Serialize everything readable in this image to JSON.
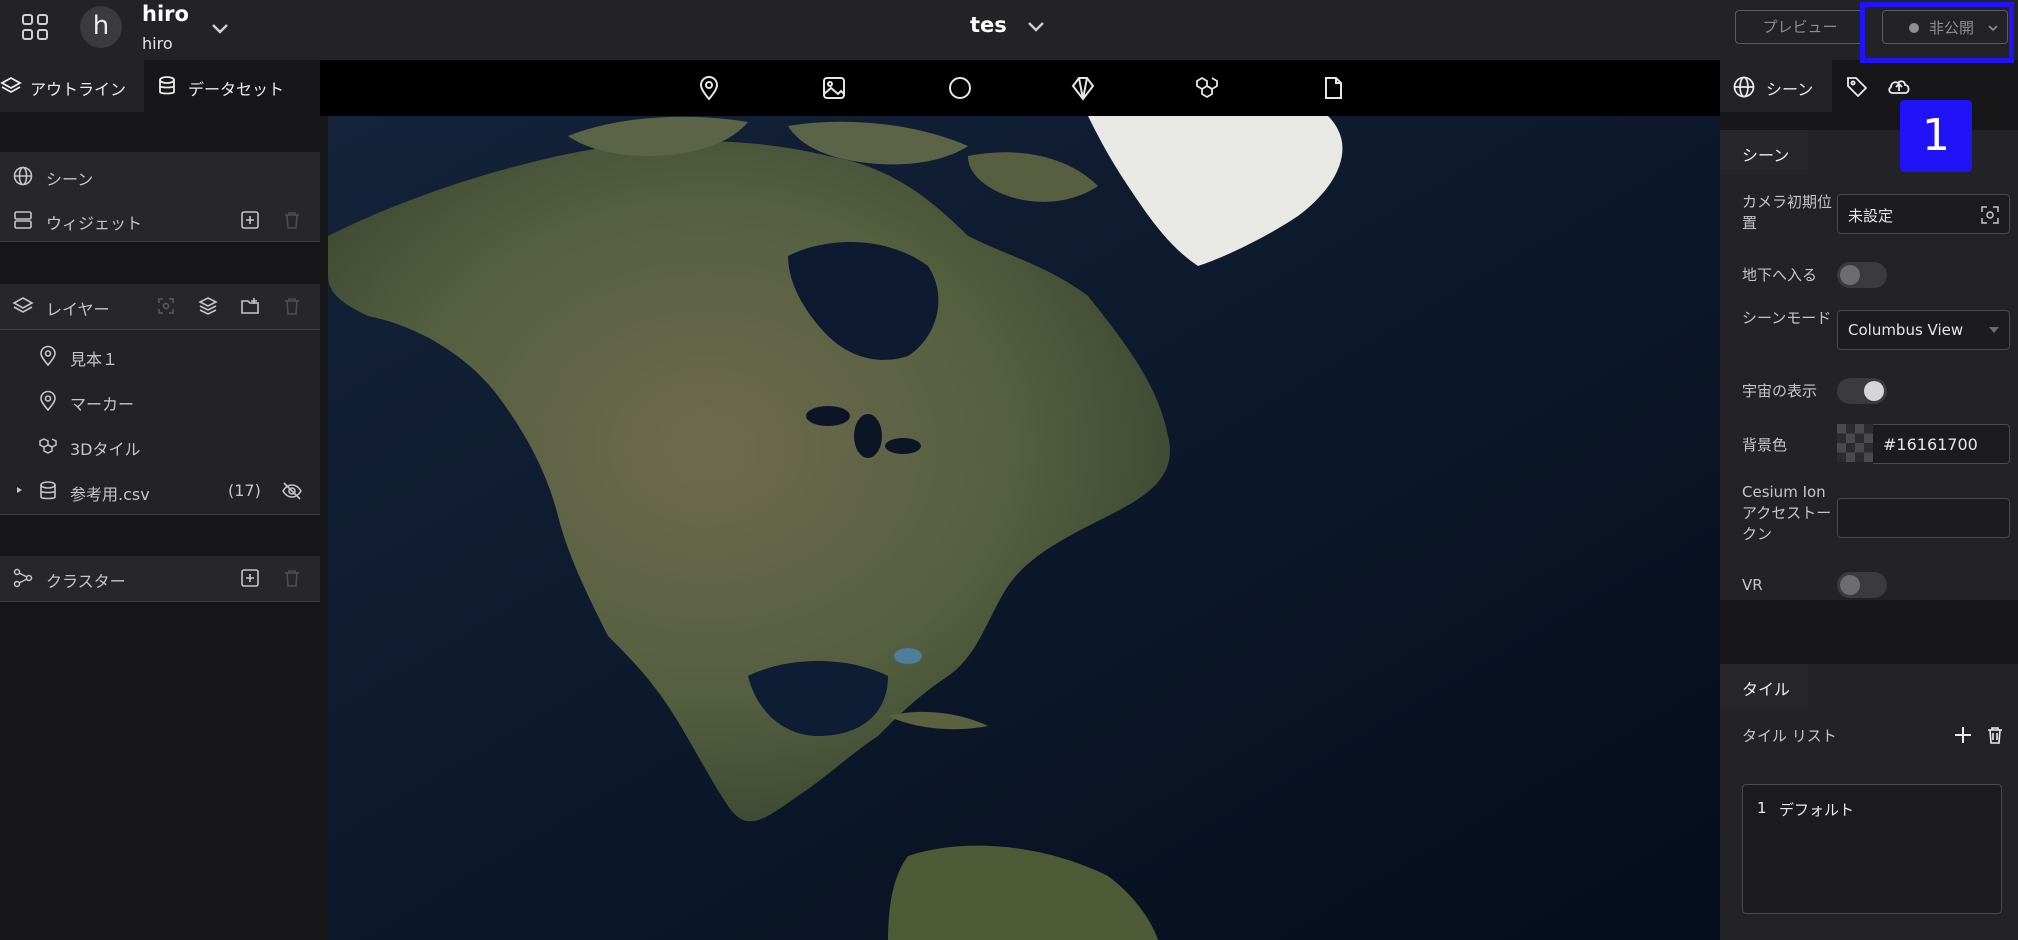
{
  "header": {
    "workspace_initial": "h",
    "workspace_name": "hiro",
    "workspace_user": "hiro",
    "project_title": "tes",
    "preview_label": "プレビュー",
    "publish_label": "非公開",
    "annotation_number": "1"
  },
  "left_panel": {
    "tabs": [
      {
        "label": "アウトライン",
        "icon": "layers-icon",
        "active": true
      },
      {
        "label": "データセット",
        "icon": "database-icon",
        "active": false
      }
    ],
    "scene_section": {
      "scene_label": "シーン",
      "widget_label": "ウィジェット"
    },
    "layer_section": {
      "header_label": "レイヤー",
      "items": [
        {
          "label": "見本１",
          "icon": "pin-icon"
        },
        {
          "label": "マーカー",
          "icon": "pin-icon"
        },
        {
          "label": "3Dタイル",
          "icon": "tiles-icon"
        },
        {
          "label": "参考用.csv",
          "icon": "database-icon",
          "count": "(17)"
        }
      ]
    },
    "cluster_section": {
      "label": "クラスター"
    }
  },
  "toolbar": {
    "tools": [
      "pin-icon",
      "image-icon",
      "circle-icon",
      "box-icon",
      "tiles-icon",
      "file-icon"
    ]
  },
  "right_panel": {
    "tabs": [
      {
        "label": "シーン",
        "icon": "globe-icon",
        "active": true
      },
      {
        "label": "",
        "icon": "tag-icon",
        "active": false
      },
      {
        "label": "",
        "icon": "cloud-upload-icon",
        "active": false
      }
    ],
    "scene_group": {
      "title": "シーン",
      "camera_label": "カメラ初期位置",
      "camera_value": "未設定",
      "underground_label": "地下へ入る",
      "underground_on": false,
      "scene_mode_label": "シーンモード",
      "scene_mode_value": "Columbus View",
      "space_label": "宇宙の表示",
      "space_on": true,
      "bg_color_label": "背景色",
      "bg_color_value": "#16161700",
      "cesium_label": "Cesium Ion アクセストークン",
      "cesium_value": "",
      "vr_label": "VR",
      "vr_on": false
    },
    "tile_group": {
      "title": "タイル",
      "list_label": "タイル リスト",
      "items": [
        {
          "index": "1",
          "label": "デフォルト"
        }
      ]
    }
  },
  "colors": {
    "accent": "#2013f7",
    "panel": "#232226",
    "background": "#171618"
  }
}
